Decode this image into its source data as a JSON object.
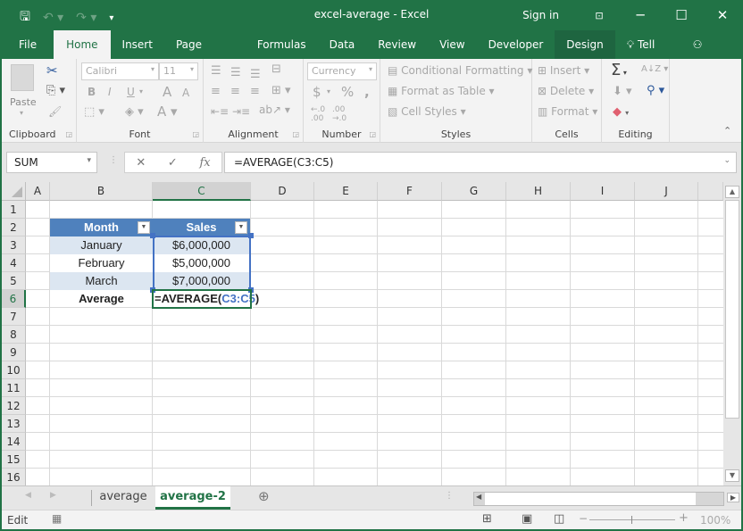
{
  "window": {
    "title": "excel-average - Excel",
    "sign_in": "Sign in",
    "ribbon_display_icon": "ribbon-display-options-icon",
    "minimize": "─",
    "maximize": "☐",
    "close": "✕"
  },
  "qat": {
    "save": "🖫",
    "undo": "↶",
    "redo": "↷",
    "customize": "⌄"
  },
  "tabs": [
    {
      "label": "File"
    },
    {
      "label": "Home"
    },
    {
      "label": "Insert"
    },
    {
      "label": "Page Layout"
    },
    {
      "label": "Formulas"
    },
    {
      "label": "Data"
    },
    {
      "label": "Review"
    },
    {
      "label": "View"
    },
    {
      "label": "Developer"
    },
    {
      "label": "Design"
    },
    {
      "label": "Tell me"
    },
    {
      "label": "Share"
    }
  ],
  "ribbon": {
    "clipboard": {
      "label": "Clipboard",
      "paste": "Paste"
    },
    "font": {
      "label": "Font",
      "font_name": "Calibri",
      "font_size": "11",
      "bold": "B",
      "italic": "I",
      "underline": "U"
    },
    "alignment": {
      "label": "Alignment"
    },
    "number": {
      "label": "Number",
      "format": "Currency",
      "currency": "$",
      "percent": "%",
      "comma": ","
    },
    "styles": {
      "label": "Styles",
      "conditional": "Conditional Formatting",
      "format_table": "Format as Table",
      "cell_styles": "Cell Styles"
    },
    "cells": {
      "label": "Cells",
      "insert": "Insert",
      "delete": "Delete",
      "format": "Format"
    },
    "editing": {
      "label": "Editing",
      "autosum": "Σ",
      "sort": "A↓Z"
    }
  },
  "formula_bar": {
    "name_box": "SUM",
    "cancel": "✕",
    "enter": "✓",
    "fx": "fx",
    "formula": "=AVERAGE(C3:C5)"
  },
  "columns": [
    "A",
    "B",
    "C",
    "D",
    "E",
    "F",
    "G",
    "H",
    "I",
    "J"
  ],
  "rows": [
    "1",
    "2",
    "3",
    "4",
    "5",
    "6",
    "7",
    "8",
    "9",
    "10",
    "11",
    "12",
    "13",
    "14",
    "15",
    "16"
  ],
  "table": {
    "headers": [
      "Month",
      "Sales"
    ],
    "rows": [
      [
        "January",
        "$6,000,000"
      ],
      [
        "February",
        "$5,000,000"
      ],
      [
        "March",
        "$7,000,000"
      ]
    ],
    "footer_label": "Average",
    "footer_formula_prefix": "=AVERAGE(",
    "footer_formula_ref": "C3:C5",
    "footer_formula_suffix": ")"
  },
  "sheet_tabs": [
    {
      "label": "average",
      "active": false
    },
    {
      "label": "average-2",
      "active": true
    }
  ],
  "status": {
    "mode": "Edit",
    "zoom": "100%"
  },
  "colors": {
    "brand": "#217346",
    "table_header": "#4f81bd",
    "table_band": "#dce6f1",
    "ref_blue": "#4472c4"
  }
}
